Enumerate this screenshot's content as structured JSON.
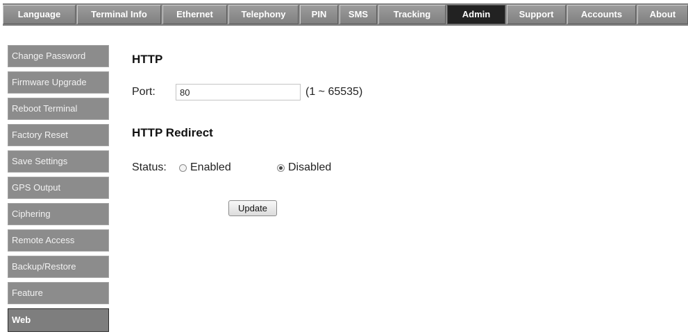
{
  "topnav": {
    "tabs": [
      "Language",
      "Terminal Info",
      "Ethernet",
      "Telephony",
      "PIN",
      "SMS",
      "Tracking",
      "Admin",
      "Support",
      "Accounts",
      "About"
    ],
    "active": "Admin"
  },
  "sidebar": {
    "items": [
      "Change Password",
      "Firmware Upgrade",
      "Reboot Terminal",
      "Factory Reset",
      "Save Settings",
      "GPS Output",
      "Ciphering",
      "Remote Access",
      "Backup/Restore",
      "Feature",
      "Web"
    ],
    "active": "Web"
  },
  "http": {
    "heading": "HTTP",
    "port_label": "Port:",
    "port_value": "80",
    "port_range": "(1 ~ 65535)"
  },
  "redirect": {
    "heading": "HTTP Redirect",
    "status_label": "Status:",
    "enabled_label": "Enabled",
    "disabled_label": "Disabled",
    "selected": "Disabled"
  },
  "update_label": "Update",
  "colors": {
    "tab_bg": "#8a8a8a",
    "tab_active_bg": "#222222",
    "sidebar_bg": "#8c8c8c",
    "page_bg": "#ffffff"
  }
}
